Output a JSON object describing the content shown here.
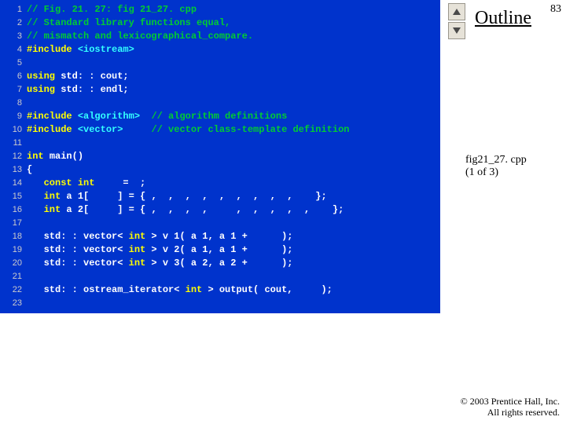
{
  "pageNumber": "83",
  "outlineLabel": "Outline",
  "caption": {
    "line1": "fig21_27. cpp",
    "line2": "(1 of 3)"
  },
  "footer": {
    "line1": "© 2003 Prentice Hall, Inc.",
    "line2": "All rights reserved."
  },
  "code": [
    {
      "n": "1",
      "seg": [
        {
          "c": "c-cm",
          "t": "// Fig. 21. 27: fig 21_27. cpp"
        }
      ]
    },
    {
      "n": "2",
      "seg": [
        {
          "c": "c-cm",
          "t": "// Standard library functions equal,"
        }
      ]
    },
    {
      "n": "3",
      "seg": [
        {
          "c": "c-cm",
          "t": "// mismatch and lexicographical_compare."
        }
      ]
    },
    {
      "n": "4",
      "seg": [
        {
          "c": "c-kw",
          "t": "#include "
        },
        {
          "c": "c-lit",
          "t": "<iostream>"
        }
      ]
    },
    {
      "n": "5",
      "seg": []
    },
    {
      "n": "6",
      "seg": [
        {
          "c": "c-kw",
          "t": "using "
        },
        {
          "c": "c-id",
          "t": "std: : cout;"
        }
      ]
    },
    {
      "n": "7",
      "seg": [
        {
          "c": "c-kw",
          "t": "using "
        },
        {
          "c": "c-id",
          "t": "std: : endl;"
        }
      ]
    },
    {
      "n": "8",
      "seg": []
    },
    {
      "n": "9",
      "seg": [
        {
          "c": "c-kw",
          "t": "#include "
        },
        {
          "c": "c-lit",
          "t": "<algorithm>"
        },
        {
          "c": "c-id",
          "t": "  "
        },
        {
          "c": "c-cm",
          "t": "// algorithm definitions"
        }
      ]
    },
    {
      "n": "10",
      "seg": [
        {
          "c": "c-kw",
          "t": "#include "
        },
        {
          "c": "c-lit",
          "t": "<vector>"
        },
        {
          "c": "c-id",
          "t": "     "
        },
        {
          "c": "c-cm",
          "t": "// vector class-template definition"
        }
      ]
    },
    {
      "n": "11",
      "seg": []
    },
    {
      "n": "12",
      "seg": [
        {
          "c": "c-kw",
          "t": "int "
        },
        {
          "c": "c-id",
          "t": "main()"
        }
      ]
    },
    {
      "n": "13",
      "seg": [
        {
          "c": "c-id",
          "t": "{"
        }
      ]
    },
    {
      "n": "14",
      "seg": [
        {
          "c": "c-id",
          "t": "   "
        },
        {
          "c": "c-kw",
          "t": "const int"
        },
        {
          "c": "c-id",
          "t": "     =  ;"
        }
      ]
    },
    {
      "n": "15",
      "seg": [
        {
          "c": "c-id",
          "t": "   "
        },
        {
          "c": "c-kw",
          "t": "int "
        },
        {
          "c": "c-id",
          "t": "a 1[     ] = { ,  ,  ,  ,  ,  ,  ,  ,  ,    };"
        }
      ]
    },
    {
      "n": "16",
      "seg": [
        {
          "c": "c-id",
          "t": "   "
        },
        {
          "c": "c-kw",
          "t": "int "
        },
        {
          "c": "c-id",
          "t": "a 2[     ] = { ,  ,  ,  ,     ,  ,  ,  ,  ,    };"
        }
      ]
    },
    {
      "n": "17",
      "seg": []
    },
    {
      "n": "18",
      "seg": [
        {
          "c": "c-id",
          "t": "   std: : vector< "
        },
        {
          "c": "c-kw",
          "t": "int"
        },
        {
          "c": "c-id",
          "t": " > v 1( a 1, a 1 +      );"
        }
      ]
    },
    {
      "n": "19",
      "seg": [
        {
          "c": "c-id",
          "t": "   std: : vector< "
        },
        {
          "c": "c-kw",
          "t": "int"
        },
        {
          "c": "c-id",
          "t": " > v 2( a 1, a 1 +      );"
        }
      ]
    },
    {
      "n": "20",
      "seg": [
        {
          "c": "c-id",
          "t": "   std: : vector< "
        },
        {
          "c": "c-kw",
          "t": "int"
        },
        {
          "c": "c-id",
          "t": " > v 3( a 2, a 2 +      );"
        }
      ]
    },
    {
      "n": "21",
      "seg": []
    },
    {
      "n": "22",
      "seg": [
        {
          "c": "c-id",
          "t": "   std: : ostream_iterator< "
        },
        {
          "c": "c-kw",
          "t": "int"
        },
        {
          "c": "c-id",
          "t": " > output( cout,     );"
        }
      ]
    },
    {
      "n": "23",
      "seg": []
    }
  ]
}
